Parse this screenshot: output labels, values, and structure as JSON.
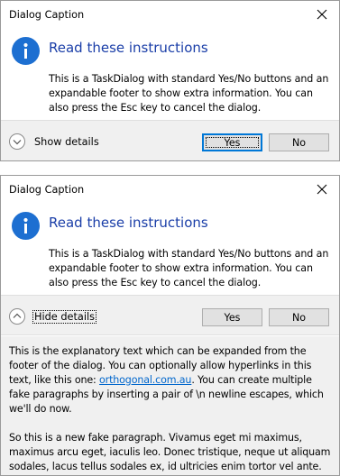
{
  "dialogs": [
    {
      "caption": "Dialog Caption",
      "main_instruction": "Read these instructions",
      "content": "This is a TaskDialog with standard Yes/No buttons and an expandable footer to show extra information. You can also press the Esc key to cancel the dialog.",
      "expander_label": "Show details",
      "expanded": false,
      "yes_label": "Yes",
      "no_label": "No"
    },
    {
      "caption": "Dialog Caption",
      "main_instruction": "Read these instructions",
      "content": "This is a TaskDialog with standard Yes/No buttons and an expandable footer to show extra information. You can also press the Esc key to cancel the dialog.",
      "expander_label": "Hide details",
      "expanded": true,
      "yes_label": "Yes",
      "no_label": "No",
      "footer": {
        "p1_before": "This is the explanatory text which can be expanded from the footer of the dialog. You can optionally allow hyperlinks in this text, like this one: ",
        "p1_link": "orthogonal.com.au",
        "p1_after": ". You can create multiple fake paragraphs by inserting a pair of \\n newline escapes, which we'll do now.",
        "p2": "So this is a new fake paragraph. Vivamus eget mi maximus, maximus arcu eget, iaculis leo. Donec tristique, neque ut aliquam sodales, lacus tellus sodales ex, id ultricies enim tortor vel ante."
      }
    }
  ],
  "colors": {
    "instruction": "#1a3ea8",
    "info_icon": "#1d6fd1",
    "link": "#0066cc",
    "footer_bg": "#f0f0f0",
    "default_button_border": "#0078d7"
  }
}
